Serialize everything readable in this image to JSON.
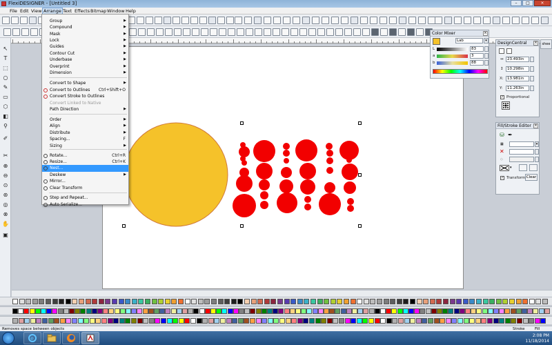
{
  "window": {
    "title": "FlexiDESIGNER - [Untitled 3]",
    "controls": [
      "–",
      "□",
      "×"
    ]
  },
  "menubar": [
    "File",
    "Edit",
    "View",
    "Arrange",
    "Text",
    "Effects",
    "Bitmap",
    "Window",
    "Help"
  ],
  "active_menu": "Arrange",
  "arrange_menu": [
    {
      "label": "Group",
      "submenu": true
    },
    {
      "label": "Compound",
      "submenu": true
    },
    {
      "label": "Mask",
      "submenu": true
    },
    {
      "label": "Lock",
      "submenu": true
    },
    {
      "label": "Guides",
      "submenu": true
    },
    {
      "label": "Contour Cut",
      "submenu": true
    },
    {
      "label": "Underbase",
      "submenu": true
    },
    {
      "label": "Overprint",
      "submenu": true
    },
    {
      "label": "Dimension",
      "submenu": true
    },
    {
      "label": "Convert to Shape",
      "submenu": true
    },
    {
      "label": "Convert to Outlines",
      "shortcut": "Ctrl+Shift+O"
    },
    {
      "label": "Convert Stroke to Outlines"
    },
    {
      "label": "Convert Linked to Native",
      "disabled": true
    },
    {
      "label": "Path Direction",
      "submenu": true
    },
    {
      "label": "Order",
      "submenu": true
    },
    {
      "label": "Align",
      "submenu": true
    },
    {
      "label": "Distribute",
      "submenu": true
    },
    {
      "label": "Spacing...",
      "shortcut": "F"
    },
    {
      "label": "Sizing",
      "submenu": true
    },
    {
      "label": "Rotate...",
      "shortcut": "Ctrl+R"
    },
    {
      "label": "Resize...",
      "shortcut": "Ctrl+K"
    },
    {
      "label": "Nest...",
      "highlighted": true
    },
    {
      "label": "Deskew",
      "submenu": true
    },
    {
      "label": "Mirror..."
    },
    {
      "label": "Clear Transform"
    },
    {
      "label": "Step and Repeat..."
    },
    {
      "label": "Auto Serialize..."
    }
  ],
  "color_mixer": {
    "title": "Color Mixer",
    "mode": "Lab",
    "rows": [
      {
        "label": "L",
        "value": "83"
      },
      {
        "label": "a",
        "value": "3"
      },
      {
        "label": "b",
        "value": "88"
      }
    ],
    "current_color": "#f5c22a"
  },
  "design_central": {
    "title": "DesignCentral",
    "fields": [
      {
        "label": "↔",
        "value": "23.493in"
      },
      {
        "label": "↕",
        "value": "10.298in"
      },
      {
        "label": "X:",
        "value": "13.981in"
      },
      {
        "label": "Y:",
        "value": "11.263in"
      }
    ],
    "proportional_label": "Proportional"
  },
  "fill_stroke": {
    "title": "Fill/Stroke Editor",
    "transform_label": "Transform",
    "clear_label": "Clear"
  },
  "side_tab": "shee",
  "canvas": {
    "circle_color": "#f5c22a",
    "circle_stroke": "#d07a3a",
    "dot_color": "#f20000"
  },
  "statusbar": {
    "message": "Removes space between objects",
    "stroke_label": "Stroke",
    "fill_label": "Fill"
  },
  "taskbar": {
    "time": "2:08 PM",
    "date": "11/18/2014"
  }
}
